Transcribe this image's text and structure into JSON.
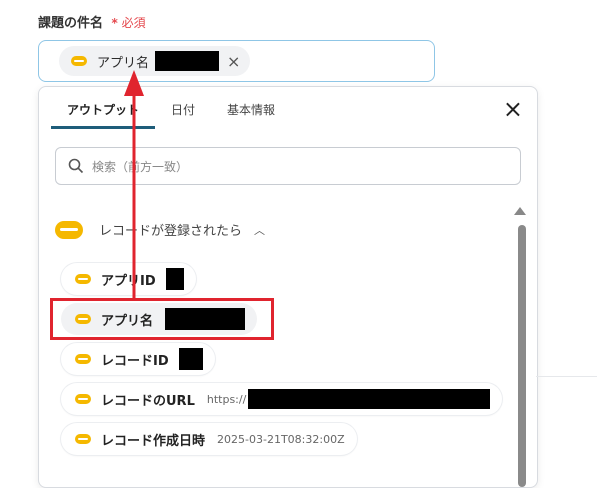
{
  "field": {
    "label": "課題の件名",
    "required_star": "*",
    "required_text": "必須",
    "chip_label": "アプリ名",
    "remove_icon": "×"
  },
  "panel": {
    "tabs": [
      {
        "label": "アウトプット",
        "active": true
      },
      {
        "label": "日付",
        "active": false
      },
      {
        "label": "基本情報",
        "active": false
      }
    ],
    "close_icon": "×",
    "search_placeholder": "検索（前方一致）",
    "section_title": "レコードが登録されたら",
    "section_icon": "kintone",
    "items": [
      {
        "label": "アプリID",
        "value": ""
      },
      {
        "label": "アプリ名",
        "value": ""
      },
      {
        "label": "レコードID",
        "value": ""
      },
      {
        "label": "レコードのURL",
        "value": "https://"
      },
      {
        "label": "レコード作成日時",
        "value": "2025-03-21T08:32:00Z"
      }
    ]
  },
  "colors": {
    "kintone_icon": "#f5b800",
    "highlight": "#e0242e",
    "active_tab": "#1e5d7a",
    "required": "#e5484d"
  }
}
